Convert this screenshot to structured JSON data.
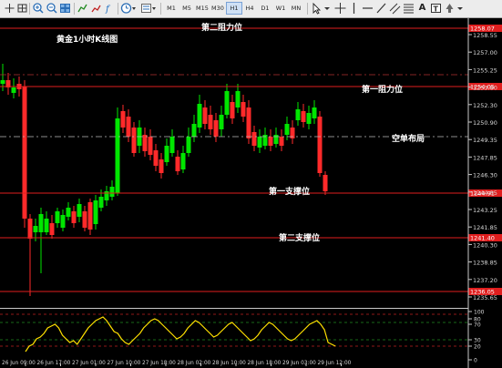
{
  "toolbar": {
    "timeframes": [
      "M1",
      "M5",
      "M15",
      "M30",
      "H1",
      "H4",
      "D1",
      "W1",
      "MN"
    ],
    "active_timeframe": "H1"
  },
  "chart": {
    "title": "黄金1小时K线图",
    "annotations": {
      "r2": "第二阻力位",
      "r1": "第一阻力位",
      "short": "空单布局",
      "s1": "第一支撑位",
      "s2": "第二支撑位"
    },
    "price_ticks": [
      "1258.55",
      "1257.00",
      "1255.25",
      "1253.80",
      "1252.30",
      "1250.90",
      "1249.35",
      "1247.85",
      "1246.30",
      "1244.85",
      "1243.25",
      "1241.85",
      "1240.30",
      "1238.85",
      "1237.20",
      "1235.65"
    ],
    "price_tags": {
      "r2": "1258.07",
      "r1": "1254.05",
      "s1": "1244.91",
      "s2": "1241.40",
      "low": "1236.05"
    },
    "time_labels": [
      "26 Jun 09:00",
      "26 Jun 17:00",
      "27 Jun 01:00",
      "27 Jun 10:00",
      "27 Jun 18:00",
      "28 Jun 02:00",
      "28 Jun 10:00",
      "28 Jun 18:00",
      "29 Jun 03:00",
      "29 Jun 12:00"
    ],
    "indicator_ticks": [
      "100",
      "80",
      "70",
      "30",
      "20",
      "0"
    ]
  },
  "colors": {
    "bull": "#00e600",
    "bear": "#ff2a2a",
    "resistance": "#e01e1e",
    "indicator": "#ffe000",
    "toolbar_bg": "#ececec"
  }
}
